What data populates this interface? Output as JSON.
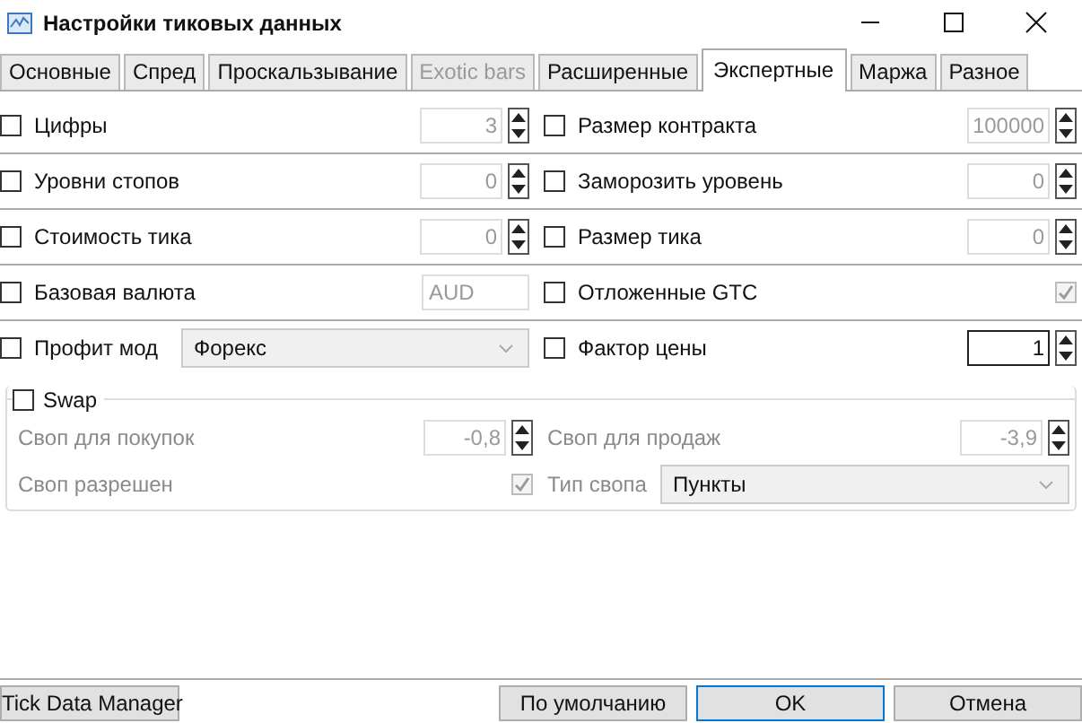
{
  "window": {
    "title": "Настройки тиковых данных"
  },
  "tabs": [
    {
      "label": "Основные",
      "selected": false,
      "disabled": false
    },
    {
      "label": "Спред",
      "selected": false,
      "disabled": false
    },
    {
      "label": "Проскальзывание",
      "selected": false,
      "disabled": false
    },
    {
      "label": "Exotic bars",
      "selected": false,
      "disabled": true
    },
    {
      "label": "Расширенные",
      "selected": false,
      "disabled": false
    },
    {
      "label": "Экспертные",
      "selected": true,
      "disabled": false
    },
    {
      "label": "Маржа",
      "selected": false,
      "disabled": false
    },
    {
      "label": "Разное",
      "selected": false,
      "disabled": false
    }
  ],
  "rows": [
    {
      "left": {
        "label": "Цифры",
        "checked": false,
        "kind": "spin",
        "value": "3",
        "disabled": true
      },
      "right": {
        "label": "Размер контракта",
        "checked": false,
        "kind": "spin",
        "value": "100000",
        "disabled": true
      }
    },
    {
      "left": {
        "label": "Уровни стопов",
        "checked": false,
        "kind": "spin",
        "value": "0",
        "disabled": true
      },
      "right": {
        "label": "Заморозить уровень",
        "checked": false,
        "kind": "spin",
        "value": "0",
        "disabled": true
      }
    },
    {
      "left": {
        "label": "Стоимость тика",
        "checked": false,
        "kind": "spin",
        "value": "0",
        "disabled": true
      },
      "right": {
        "label": "Размер тика",
        "checked": false,
        "kind": "spin",
        "value": "0",
        "disabled": true
      }
    },
    {
      "left": {
        "label": "Базовая валюта",
        "checked": false,
        "kind": "text",
        "value": "AUD",
        "disabled": true
      },
      "right": {
        "label": "Отложенные GTC",
        "checked": false,
        "kind": "check",
        "on": true,
        "disabled": true
      }
    },
    {
      "left": {
        "label": "Профит мод",
        "checked": false,
        "kind": "combo",
        "value": "Форекс",
        "disabled": true
      },
      "right": {
        "label": "Фактор цены",
        "checked": false,
        "kind": "spin",
        "value": "1",
        "disabled": false
      }
    }
  ],
  "swap": {
    "label": "Swap",
    "checked": false,
    "rows": [
      {
        "left": {
          "label": "Своп для покупок",
          "kind": "spin",
          "value": "-0,8",
          "disabled": true
        },
        "right": {
          "label": "Своп для продаж",
          "kind": "spin",
          "value": "-3,9",
          "disabled": true
        }
      },
      {
        "left": {
          "label": "Своп разрешен",
          "kind": "check",
          "on": true,
          "disabled": true
        },
        "right": {
          "label": "Тип свопа",
          "kind": "combo",
          "value": "Пункты",
          "disabled": true
        }
      }
    ]
  },
  "footer": {
    "left_button": {
      "label": "Tick Data Manager"
    },
    "buttons": [
      {
        "label": "По умолчанию",
        "default": false
      },
      {
        "label": "OK",
        "default": true
      },
      {
        "label": "Отмена",
        "default": false
      }
    ]
  }
}
